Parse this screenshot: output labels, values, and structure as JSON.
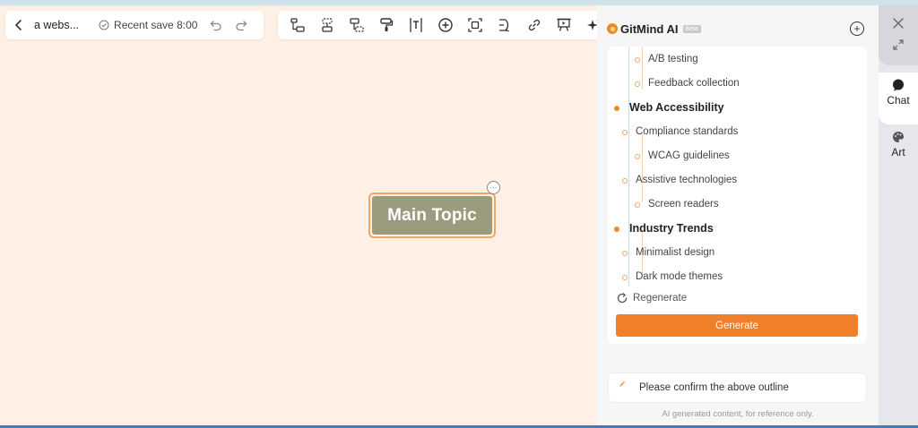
{
  "nav": {
    "doc_title": "a webs...",
    "save_status": "Recent save 8:00"
  },
  "toolbar": {
    "tools": [
      "sibling-node",
      "child-node",
      "parent-node",
      "format-painter",
      "text",
      "insert",
      "summary",
      "relationship",
      "link",
      "present",
      "ai-magic"
    ]
  },
  "canvas": {
    "main_topic": "Main Topic",
    "more_glyph": "···",
    "background_color": "#fef0e5",
    "topic_color": "#9a9c7d",
    "topic_border_color": "#f0a766"
  },
  "ai_panel": {
    "title": "GitMind AI",
    "badge": "Beta",
    "outline": [
      {
        "level": 3,
        "text": "A/B testing"
      },
      {
        "level": 3,
        "text": "Feedback collection"
      },
      {
        "level": 1,
        "text": "Web Accessibility"
      },
      {
        "level": 2,
        "text": "Compliance standards"
      },
      {
        "level": 3,
        "text": "WCAG guidelines"
      },
      {
        "level": 2,
        "text": "Assistive technologies"
      },
      {
        "level": 3,
        "text": "Screen readers"
      },
      {
        "level": 1,
        "text": "Industry Trends"
      },
      {
        "level": 2,
        "text": "Minimalist design"
      },
      {
        "level": 2,
        "text": "Dark mode themes"
      }
    ],
    "regenerate_label": "Regenerate",
    "generate_label": "Generate",
    "confirm_message": "Please confirm the above outline",
    "disclaimer": "AI generated content, for reference only.",
    "accent_color": "#f07f2a"
  },
  "rail": {
    "tabs": [
      {
        "label": "Chat",
        "icon": "chat-icon"
      },
      {
        "label": "Art",
        "icon": "palette-icon"
      }
    ]
  }
}
